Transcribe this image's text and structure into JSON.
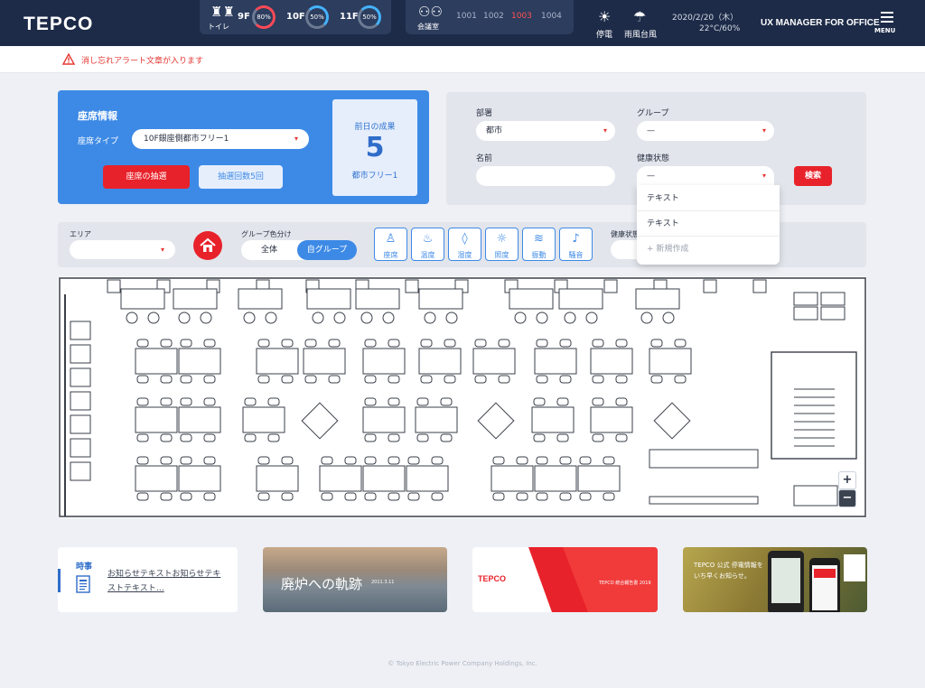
{
  "header": {
    "logo": "TEPCO",
    "toilet": {
      "label": "トイレ",
      "icon": "toilet-icon",
      "floors": [
        {
          "floor": "9F",
          "percent": "80%",
          "level": 0.8,
          "color": "#ff4a55"
        },
        {
          "floor": "10F",
          "percent": "50%",
          "level": 0.5,
          "color": "#45b3ff"
        },
        {
          "floor": "11F",
          "percent": "50%",
          "level": 0.5,
          "color": "#45b3ff"
        }
      ]
    },
    "meeting": {
      "label": "会議室",
      "icon": "meeting-room-icon",
      "rooms": [
        "1001",
        "1002",
        "1003",
        "1004"
      ],
      "active_room": "1003"
    },
    "weather": {
      "outage": {
        "label": "停電",
        "icon": "lightbulb-icon"
      },
      "storm": {
        "label": "雨風台風",
        "icon": "typhoon-icon"
      },
      "date": "2020/2/20（木）",
      "temp": "22°C/60%"
    },
    "product": "UX MANAGER FOR OFFICE",
    "menu_label": "MENU"
  },
  "alert": {
    "text": "消し忘れアラート文章が入ります",
    "color": "#e53935"
  },
  "seat_info": {
    "title": "座席情報",
    "type_label": "座席タイプ",
    "type_value": "10F銀座側都市フリー1",
    "lottery_button": "座席の抽選",
    "count_button": "抽選回数5回",
    "result": {
      "label": "前日の成果",
      "value": "5",
      "sub": "都市フリー1"
    }
  },
  "search": {
    "dept_label": "部署",
    "dept_value": "都市",
    "group_label": "グループ",
    "group_value": "—",
    "name_label": "名前",
    "name_value": "",
    "health_label": "健康状態",
    "health_value": "—",
    "search_button": "検索",
    "dropdown": [
      "テキスト",
      "テキスト"
    ],
    "dropdown_new": "+ 新規作成"
  },
  "filter": {
    "area_label": "エリア",
    "area_value": "",
    "group_color_label": "グループ色分け",
    "toggle_all": "全体",
    "toggle_group": "自グループ",
    "health_label": "健康状態",
    "sensors": [
      {
        "label": "座席",
        "icon": "seat-sensor-icon",
        "glyph": "♙"
      },
      {
        "label": "温度",
        "icon": "thermometer-icon",
        "glyph": "♨"
      },
      {
        "label": "湿度",
        "icon": "humidity-icon",
        "glyph": "◊"
      },
      {
        "label": "照度",
        "icon": "illuminance-icon",
        "glyph": "☼"
      },
      {
        "label": "振動",
        "icon": "vibration-icon",
        "glyph": "≋"
      },
      {
        "label": "騒音",
        "icon": "noise-icon",
        "glyph": "♪"
      }
    ]
  },
  "map": {
    "zoom_in": "+",
    "zoom_out": "−"
  },
  "cards": {
    "news_tag": "時事",
    "news_text": "お知らせテキストお知らせテキストテキスト…",
    "banner1_title": "廃炉への軌跡",
    "banner1_sub": "2011.3.11",
    "banner2_logo": "TEPCO",
    "banner2_sub": "TEPCO 統合報告書 2019",
    "banner3_text": "TEPCO 公式 停電情報を いち早くお知らせ。"
  },
  "footer": "© Tokyo Electric Power Company Holdings, Inc."
}
